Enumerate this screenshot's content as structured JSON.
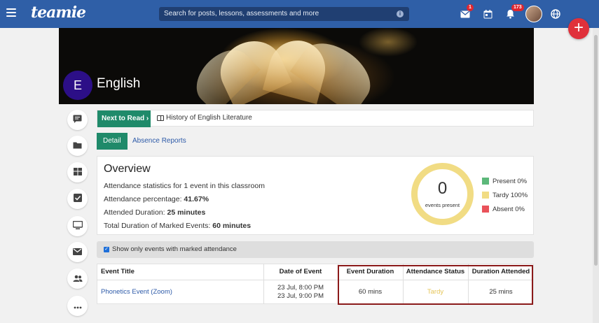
{
  "topbar": {
    "logo": "teamie",
    "search_placeholder": "Search for posts, lessons, assessments and more",
    "mail_badge": "1",
    "notifications_badge": "173",
    "icons": [
      "menu-icon",
      "mail-icon",
      "calendar-icon",
      "bell-icon",
      "globe-icon",
      "info-icon"
    ]
  },
  "fab": {
    "label": "+"
  },
  "classroom": {
    "initial": "E",
    "title": "English"
  },
  "next_to_read": {
    "button": "Next to Read ›",
    "item": "History of English Literature"
  },
  "tabs": [
    {
      "label": "Detail",
      "active": true
    },
    {
      "label": "Absence Reports",
      "active": false
    }
  ],
  "overview": {
    "title": "Overview",
    "statistics_text": "Attendance statistics for 1 event in this classroom",
    "percentage_label": "Attendance percentage: ",
    "percentage_value": "41.67%",
    "attended_label": "Attended Duration: ",
    "attended_value": "25 minutes",
    "total_label": "Total Duration of Marked Events: ",
    "total_value": "60 minutes",
    "donut_count": "0",
    "donut_label": "events present",
    "legend": [
      {
        "label": "Present 0%",
        "color": "#5cb87a"
      },
      {
        "label": "Tardy 100%",
        "color": "#f1dc84"
      },
      {
        "label": "Absent 0%",
        "color": "#e9525a"
      }
    ]
  },
  "filter": {
    "checked": true,
    "label": "Show only events with marked attendance"
  },
  "table": {
    "headers": [
      "Event Title",
      "Date of Event",
      "Event Duration",
      "Attendance Status",
      "Duration Attended"
    ],
    "rows": [
      {
        "title": "Phonetics Event (Zoom)",
        "date_start": "23 Jul, 8:00 PM",
        "date_end": "23 Jul, 9:00 PM",
        "duration": "60 mins",
        "status": "Tardy",
        "status_color": "#e6c65a",
        "attended": "25 mins"
      }
    ]
  },
  "side_icons": [
    "chat-icon",
    "folder-icon",
    "dashboard-icon",
    "checkbox-icon",
    "monitor-icon",
    "mail-icon",
    "people-icon",
    "more-icon"
  ]
}
